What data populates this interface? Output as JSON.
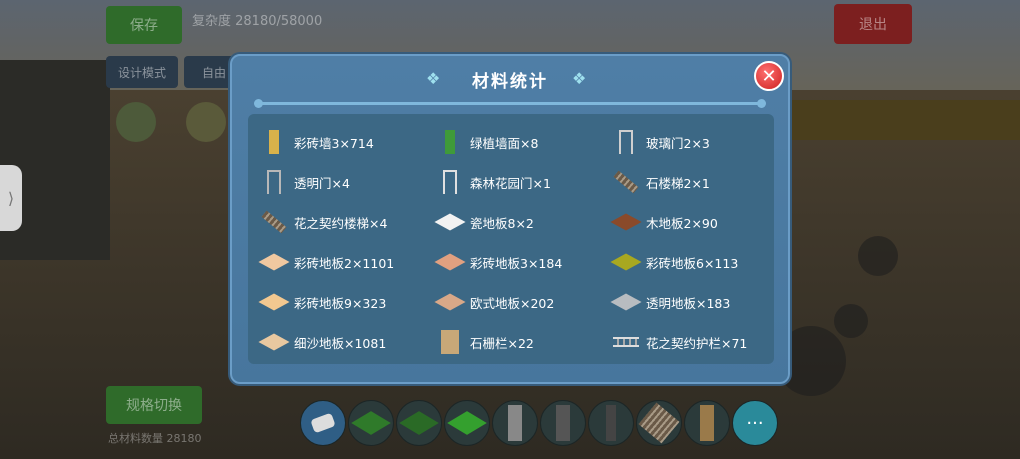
{
  "background": {
    "save_label": "保存",
    "exit_label": "退出",
    "complexity_text": "复杂度 28180/58000",
    "design_mode_label": "设计模式",
    "free_label": "自由",
    "switch_label": "规格切换",
    "bottom_stat": "总材料数量 28180"
  },
  "dialog": {
    "title": "材料统计",
    "close_label": "✕",
    "items": [
      {
        "label": "彩砖墙3×714",
        "icon": "wall-icon",
        "color": "#d9b24a"
      },
      {
        "label": "绿植墙面×8",
        "icon": "plant-wall-icon",
        "color": "#3f9a3a"
      },
      {
        "label": "玻璃门2×3",
        "icon": "glass-door-icon",
        "color": "#cfcfcf"
      },
      {
        "label": "透明门×4",
        "icon": "transparent-door-icon",
        "color": "#b8b8b8"
      },
      {
        "label": "森林花园门×1",
        "icon": "garden-gate-icon",
        "color": "#e0e0e0"
      },
      {
        "label": "石楼梯2×1",
        "icon": "stone-stairs-icon",
        "color": "#8a7a64"
      },
      {
        "label": "花之契约楼梯×4",
        "icon": "flower-stairs-icon",
        "color": "#d0d0d0"
      },
      {
        "label": "瓷地板8×2",
        "icon": "porcelain-floor-icon",
        "color": "#f2f2f2"
      },
      {
        "label": "木地板2×90",
        "icon": "wood-floor-icon",
        "color": "#8a4a2a"
      },
      {
        "label": "彩砖地板2×1101",
        "icon": "tile-floor-icon",
        "color": "#f0c8a0"
      },
      {
        "label": "彩砖地板3×184",
        "icon": "tile-floor-icon",
        "color": "#e0a080"
      },
      {
        "label": "彩砖地板6×113",
        "icon": "tile-floor-icon",
        "color": "#a8a820"
      },
      {
        "label": "彩砖地板9×323",
        "icon": "tile-floor-icon",
        "color": "#f2c890"
      },
      {
        "label": "欧式地板×202",
        "icon": "euro-floor-icon",
        "color": "#d8a888"
      },
      {
        "label": "透明地板×183",
        "icon": "transparent-floor-icon",
        "color": "#b8bcc0"
      },
      {
        "label": "细沙地板×1081",
        "icon": "sand-floor-icon",
        "color": "#e8c8a0"
      },
      {
        "label": "石栅栏×22",
        "icon": "stone-fence-icon",
        "color": "#c8a878"
      },
      {
        "label": "花之契约护栏×71",
        "icon": "flower-railing-icon",
        "color": "#e0e0e0"
      }
    ]
  },
  "hotbar": {
    "more_label": "···"
  },
  "colors": {
    "dialog_bg": "#4f7ea6",
    "content_bg": "#3c6885",
    "close_red": "#cc2020"
  }
}
